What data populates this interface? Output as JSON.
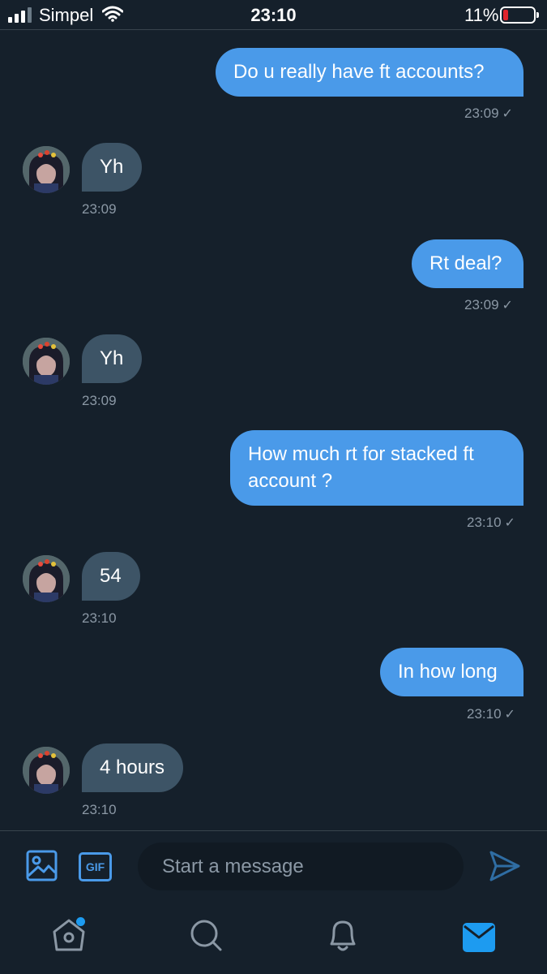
{
  "status_bar": {
    "carrier": "Simpel",
    "time": "23:10",
    "battery_percent": "11%",
    "battery_level": 0.11,
    "battery_color": "#e0242c"
  },
  "colors": {
    "background": "#15202b",
    "outgoing_bubble": "#4a9ae9",
    "incoming_bubble": "#3d5466",
    "timestamp": "#8b98a5",
    "accent": "#1d9bf0"
  },
  "messages": [
    {
      "direction": "outgoing",
      "text": "Do u really have ft accounts?",
      "time": "23:09",
      "status_icon": "check-icon"
    },
    {
      "direction": "incoming",
      "text": "Yh",
      "time": "23:09"
    },
    {
      "direction": "outgoing",
      "text": "Rt deal?",
      "time": "23:09",
      "status_icon": "check-icon"
    },
    {
      "direction": "incoming",
      "text": "Yh",
      "time": "23:09"
    },
    {
      "direction": "outgoing",
      "text": "How much rt for stacked ft account ?",
      "time": "23:10",
      "status_icon": "check-icon"
    },
    {
      "direction": "incoming",
      "text": "54",
      "time": "23:10"
    },
    {
      "direction": "outgoing",
      "text": "In how long",
      "time": "23:10",
      "status_icon": "check-icon"
    },
    {
      "direction": "incoming",
      "text": "4 hours",
      "time": "23:10"
    }
  ],
  "check_mark": "✓",
  "composer": {
    "placeholder": "Start a message",
    "gif_label": "GIF",
    "icons": [
      "image-icon",
      "gif-icon",
      "send-icon"
    ]
  },
  "tab_bar": {
    "items": [
      "home-icon",
      "search-icon",
      "notifications-icon",
      "messages-icon"
    ],
    "active": "messages-icon",
    "home_has_unread_dot": true
  }
}
